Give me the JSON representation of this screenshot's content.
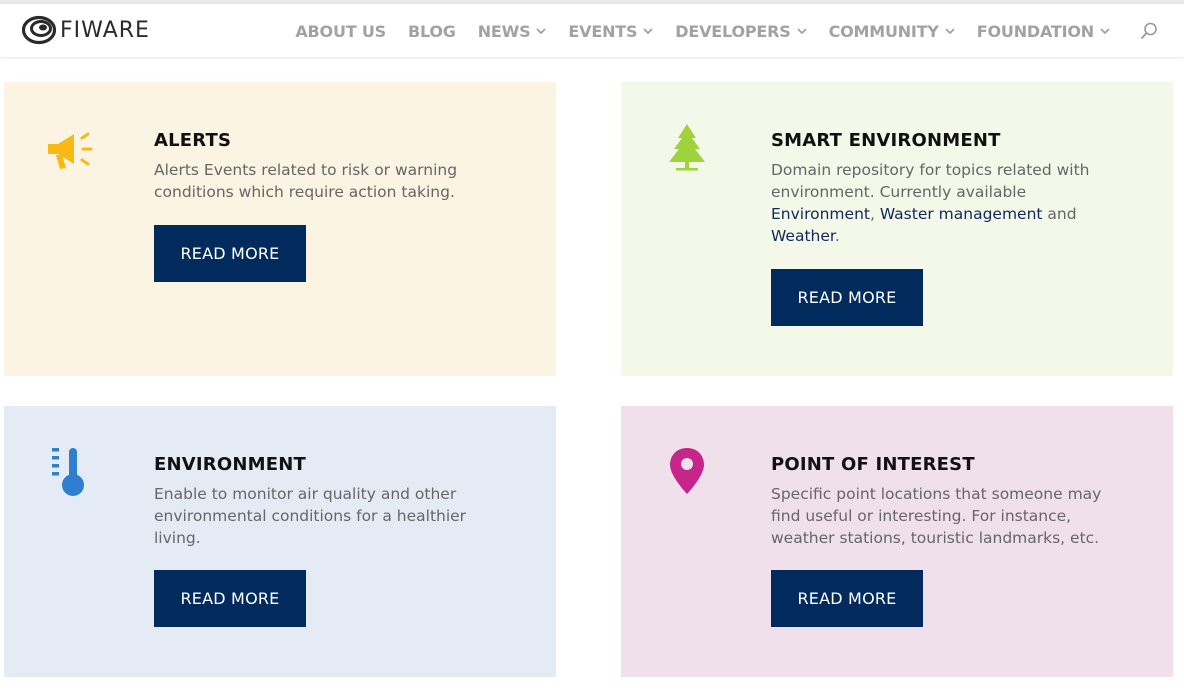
{
  "header": {
    "logo_text": "FIWARE",
    "nav": [
      {
        "label": "ABOUT US",
        "dropdown": false
      },
      {
        "label": "BLOG",
        "dropdown": false
      },
      {
        "label": "NEWS",
        "dropdown": true
      },
      {
        "label": "EVENTS",
        "dropdown": true
      },
      {
        "label": "DEVELOPERS",
        "dropdown": true
      },
      {
        "label": "COMMUNITY",
        "dropdown": true
      },
      {
        "label": "FOUNDATION",
        "dropdown": true
      }
    ],
    "search_icon": "search-icon"
  },
  "cards": [
    {
      "id": "alerts",
      "icon": "megaphone-icon",
      "icon_color": "#f9b915",
      "background": "#fcf4e2",
      "title": "ALERTS",
      "description": "Alerts Events related to risk or warning conditions which require action taking.",
      "button": "READ MORE"
    },
    {
      "id": "smart-environment",
      "icon": "tree-icon",
      "icon_color": "#a0d23c",
      "background": "#f3f8e8",
      "title": "SMART ENVIRONMENT",
      "description_parts": {
        "lead": "Domain repository for topics related with environment. Currently available ",
        "link1": "Environment",
        "sep1": ", ",
        "link2": "Waster management",
        "sep2": " and ",
        "link3": "Weather",
        "tail": "."
      },
      "button": "READ MORE"
    },
    {
      "id": "environment",
      "icon": "thermometer-icon",
      "icon_color": "#2e7fd0",
      "background": "#e5ebf5",
      "title": "ENVIRONMENT",
      "description": "Enable to monitor air quality and other environmental conditions for a healthier living.",
      "button": "READ MORE"
    },
    {
      "id": "point-of-interest",
      "icon": "map-pin-icon",
      "icon_color": "#c6258a",
      "background": "#f0e0ec",
      "title": "POINT OF INTEREST",
      "description": "Specific point locations that someone may find useful or interesting. For instance, weather stations, touristic landmarks, etc.",
      "button": "READ MORE"
    }
  ],
  "colors": {
    "button_bg": "#002b5c",
    "button_text": "#ffffff",
    "nav_text": "#a2a2a2",
    "link_text": "#13285a"
  }
}
